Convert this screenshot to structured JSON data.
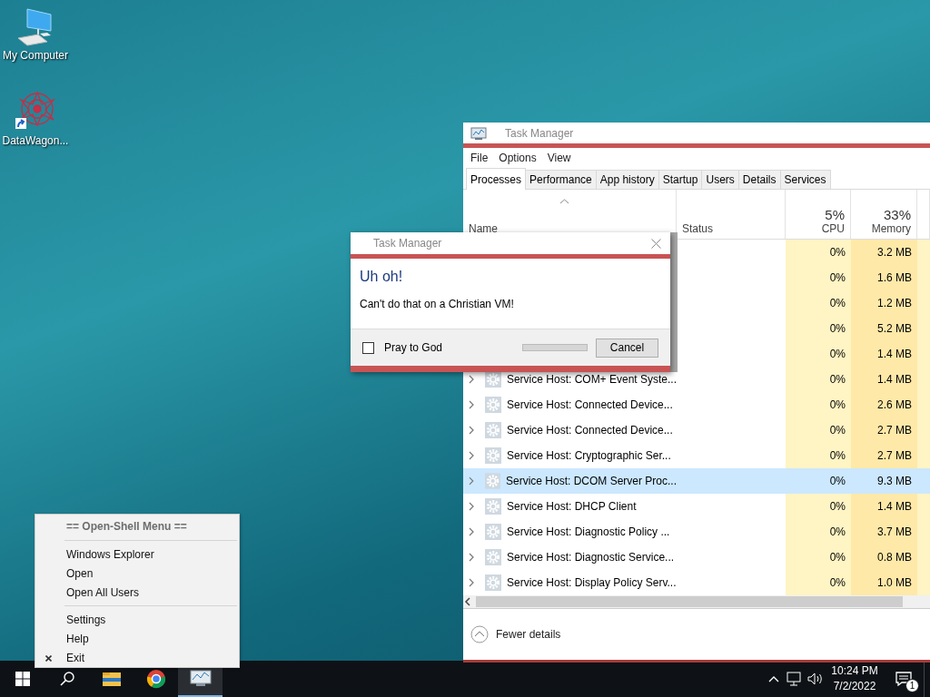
{
  "desktop": {
    "icons": [
      {
        "label": "My Computer",
        "kind": "computer"
      },
      {
        "label": "DataWagon...",
        "kind": "shortcut"
      }
    ]
  },
  "task_manager": {
    "title": "Task Manager",
    "menu": [
      "File",
      "Options",
      "View"
    ],
    "tabs": [
      {
        "label": "Processes",
        "selected": true
      },
      {
        "label": "Performance",
        "selected": false
      },
      {
        "label": "App history",
        "selected": false
      },
      {
        "label": "Startup",
        "selected": false
      },
      {
        "label": "Users",
        "selected": false
      },
      {
        "label": "Details",
        "selected": false
      },
      {
        "label": "Services",
        "selected": false
      }
    ],
    "columns": {
      "name": "Name",
      "status": "Status",
      "cpu_total": "5%",
      "cpu": "CPU",
      "memory_total": "33%",
      "memory": "Memory"
    },
    "rows": [
      {
        "cpu": "0%",
        "memory": "3.2 MB",
        "selected": false
      },
      {
        "cpu": "0%",
        "memory": "1.6 MB",
        "selected": false
      },
      {
        "cpu": "0%",
        "memory": "1.2 MB",
        "selected": false
      },
      {
        "cpu": "0%",
        "memory": "5.2 MB",
        "selected": false
      },
      {
        "cpu": "0%",
        "memory": "1.4 MB",
        "selected": false
      },
      {
        "name": "Service Host: COM+ Event Syste...",
        "cpu": "0%",
        "memory": "1.4 MB",
        "selected": false
      },
      {
        "name": "Service Host: Connected Device...",
        "cpu": "0%",
        "memory": "2.6 MB",
        "selected": false
      },
      {
        "name": "Service Host: Connected Device...",
        "cpu": "0%",
        "memory": "2.7 MB",
        "selected": false
      },
      {
        "name": "Service Host: Cryptographic Ser...",
        "cpu": "0%",
        "memory": "2.7 MB",
        "selected": false
      },
      {
        "name": "Service Host: DCOM Server Proc...",
        "cpu": "0%",
        "memory": "9.3 MB",
        "selected": true
      },
      {
        "name": "Service Host: DHCP Client",
        "cpu": "0%",
        "memory": "1.4 MB",
        "selected": false
      },
      {
        "name": "Service Host: Diagnostic Policy ...",
        "cpu": "0%",
        "memory": "3.7 MB",
        "selected": false
      },
      {
        "name": "Service Host: Diagnostic Service...",
        "cpu": "0%",
        "memory": "0.8 MB",
        "selected": false
      },
      {
        "name": "Service Host: Display Policy Serv...",
        "cpu": "0%",
        "memory": "1.0 MB",
        "selected": false
      }
    ],
    "footer": "Fewer details"
  },
  "dialog": {
    "title": "Task Manager",
    "heading": "Uh oh!",
    "message": "Can't do that on a Christian VM!",
    "checkbox": {
      "label": "Pray to God",
      "checked": false
    },
    "progress": {
      "level": 0
    },
    "button": "Cancel"
  },
  "context_menu": {
    "header": "== Open-Shell Menu ==",
    "groups": [
      [
        {
          "label": "Windows Explorer",
          "kind": "plain"
        },
        {
          "label": "Open",
          "kind": "plain"
        },
        {
          "label": "Open All Users",
          "kind": "plain"
        }
      ],
      [
        {
          "label": "Settings",
          "kind": "plain"
        },
        {
          "label": "Help",
          "kind": "plain"
        },
        {
          "label": "Exit",
          "kind": "exit"
        }
      ]
    ]
  },
  "taskbar": {
    "apps": [
      {
        "kind": "explorer",
        "active": false
      },
      {
        "kind": "browser",
        "active": false
      },
      {
        "kind": "taskmgr",
        "active": true
      }
    ],
    "time": "10:24 PM",
    "date": "7/2/2022",
    "notifications": "1"
  }
}
